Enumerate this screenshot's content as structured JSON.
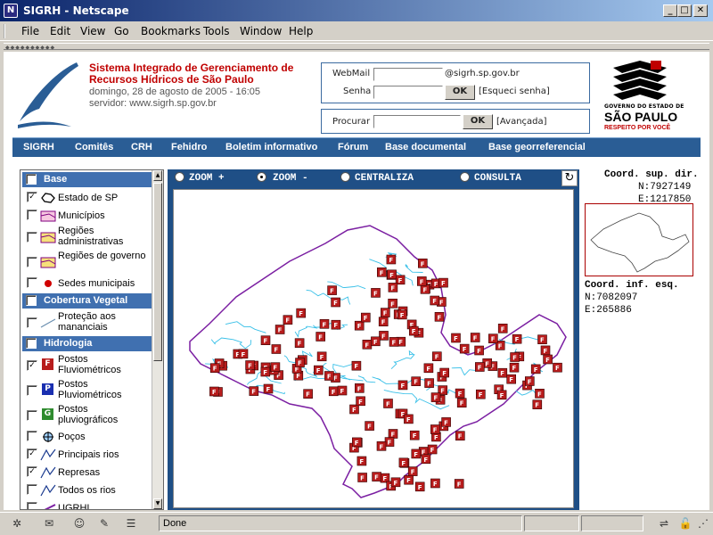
{
  "window": {
    "title": "SIGRH - Netscape",
    "minimize_label": "_",
    "maximize_label": "□",
    "close_label": "✕",
    "app_icon_glyph": "N"
  },
  "menu": [
    "File",
    "Edit",
    "View",
    "Go",
    "Bookmarks",
    "Tools",
    "Window",
    "Help"
  ],
  "header": {
    "title_line1": "Sistema Integrado de Gerenciamento de",
    "title_line2": "Recursos Hídricos de São Paulo",
    "date": "domingo, 28 de agosto de 2005 - 16:05",
    "server": "servidor: www.sigrh.sp.gov.br"
  },
  "login": {
    "webmail_label": "WebMail",
    "domain_suffix": "@sigrh.sp.gov.br",
    "password_label": "Senha",
    "ok_label": "OK",
    "forgot_link": "[Esqueci senha]"
  },
  "search": {
    "label": "Procurar",
    "ok_label": "OK",
    "advanced_link": "[Avançada]"
  },
  "gov_logo": {
    "line1": "GOVERNO DO ESTADO DE",
    "line2": "SÃO PAULO",
    "line3": "RESPEITO POR VOCÊ"
  },
  "nav": [
    "SIGRH",
    "Comitês",
    "CRH",
    "Fehidro",
    "Boletim informativo",
    "Fórum",
    "Base documental",
    "Base georreferencial"
  ],
  "layers": {
    "groups": [
      {
        "label": "Base",
        "checked": false
      },
      {
        "label": "Cobertura Vegetal",
        "checked": false
      },
      {
        "label": "Hidrologia",
        "checked": false
      }
    ],
    "items": [
      {
        "label": "Estado de SP",
        "checked": true
      },
      {
        "label": "Municípios",
        "checked": false
      },
      {
        "label": "Regiões administrativas",
        "checked": false
      },
      {
        "label": "Regiões de governo",
        "checked": false
      },
      {
        "label": "Sedes municipais",
        "checked": false
      },
      {
        "label": "Proteção aos mananciais",
        "checked": false
      },
      {
        "label": "Postos Fluviométricos",
        "checked": true
      },
      {
        "label": "Postos Pluviométricos",
        "checked": false
      },
      {
        "label": "Postos pluviográficos",
        "checked": false
      },
      {
        "label": "Poços",
        "checked": false
      },
      {
        "label": "Principais rios",
        "checked": true
      },
      {
        "label": "Represas",
        "checked": true
      },
      {
        "label": "Todos os rios",
        "checked": false
      },
      {
        "label": "UGRHI",
        "checked": false
      }
    ],
    "check_glyph": "✓",
    "icon_letters": {
      "fluvio": "F",
      "pluvio": "P",
      "pluviografo": "G"
    }
  },
  "map": {
    "tools": [
      {
        "label": "ZOOM +",
        "selected": false
      },
      {
        "label": "ZOOM -",
        "selected": true
      },
      {
        "label": "CENTRALIZA",
        "selected": false
      },
      {
        "label": "CONSULTA",
        "selected": false
      }
    ],
    "refresh_glyph": "↻",
    "marker_letter": "F",
    "colors": {
      "state_outline": "#7b1fa2",
      "rivers": "#39c0e8",
      "marker": "#b71c1c"
    }
  },
  "coords": {
    "sup_label": "Coord. sup. dir.",
    "sup_n": "N:7927149",
    "sup_e": "E:1217850",
    "inf_label": "Coord. inf. esq.",
    "inf_n": "N:7082097",
    "inf_e": "E:265886"
  },
  "status": {
    "text": "Done"
  }
}
